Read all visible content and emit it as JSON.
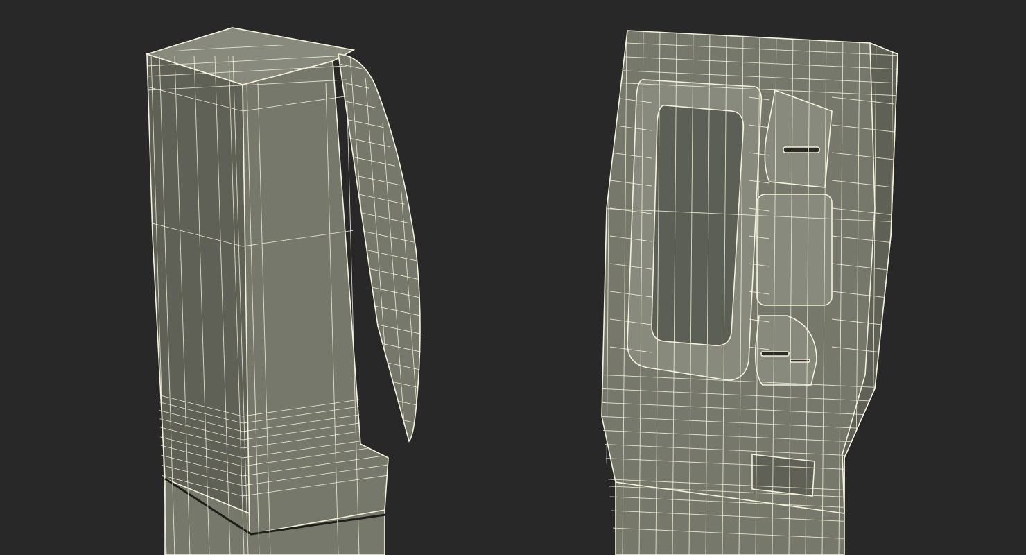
{
  "scene": {
    "background_color": "#282828",
    "object_fill_color": "#76786b",
    "object_fill_shadow": "#5f6157",
    "object_fill_light": "#878a7c",
    "wire_color": "#f4f2dc",
    "screen_color": "#5c5f55"
  },
  "objects": [
    {
      "name": "parking-meter-side-view"
    },
    {
      "name": "parking-meter-front-view"
    }
  ]
}
